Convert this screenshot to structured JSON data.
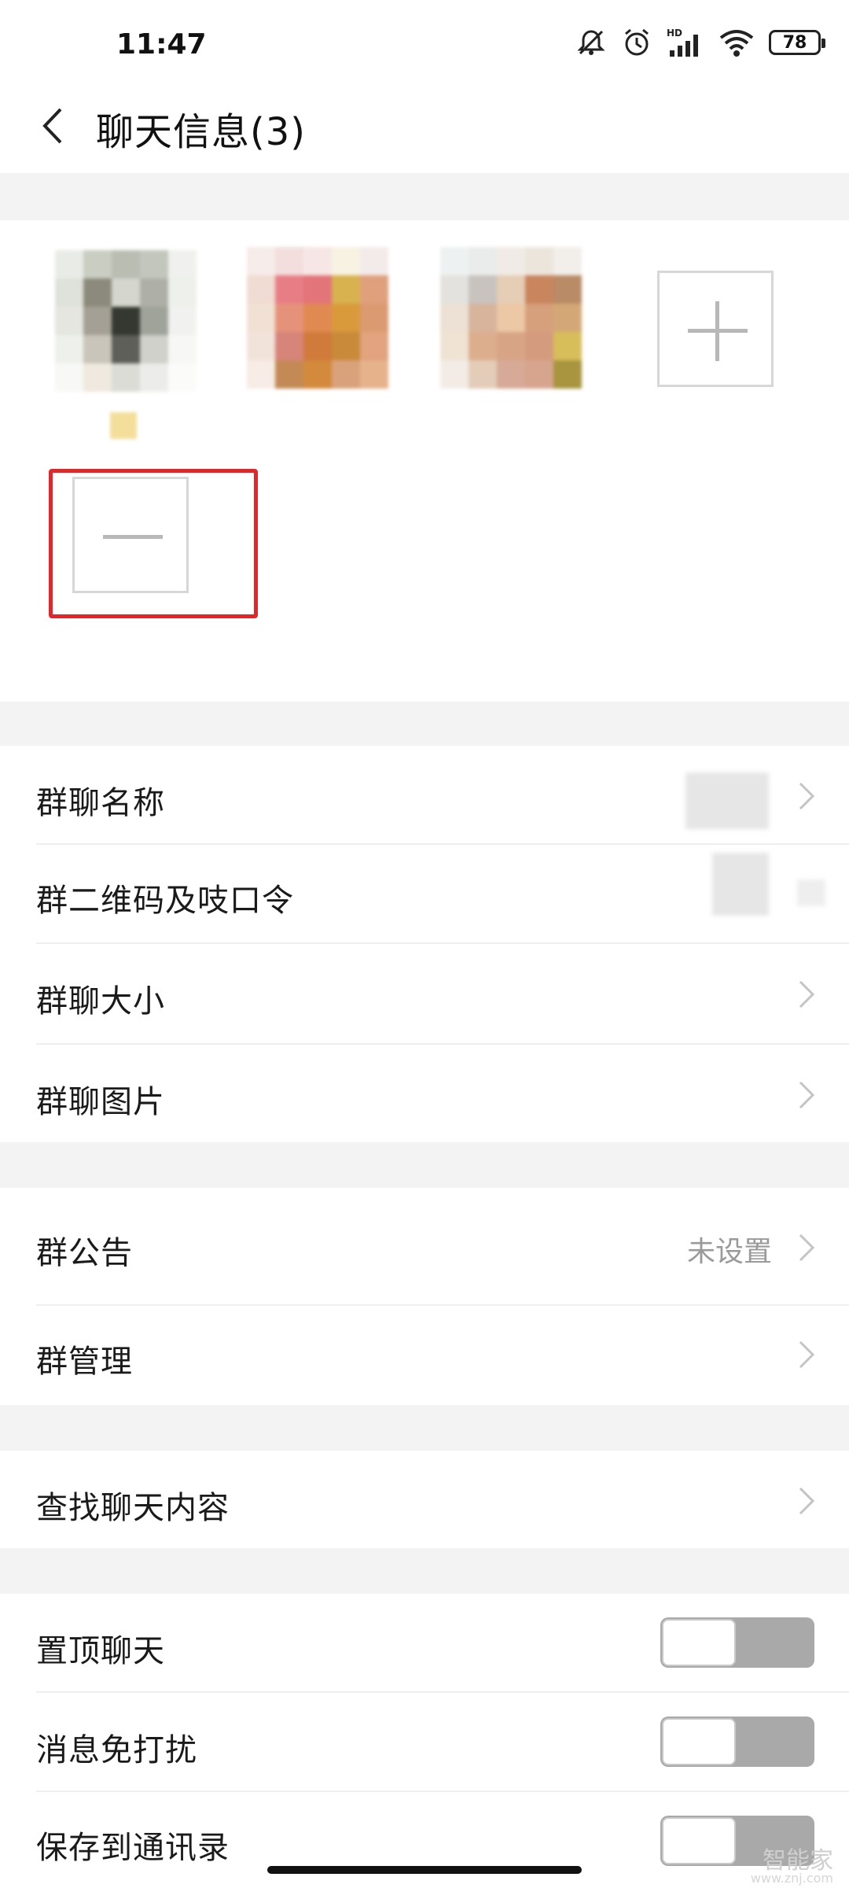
{
  "status_bar": {
    "time": "11:47",
    "icons": [
      "mute-bell-icon",
      "alarm-icon",
      "hd-signal-icon",
      "wifi-icon",
      "battery-icon"
    ],
    "signal_label": "HD",
    "battery_level": "78"
  },
  "header": {
    "back_icon": "chevron-left-icon",
    "title": "聊天信息(3)"
  },
  "members": {
    "avatars": [
      "member-avatar-1",
      "member-avatar-2",
      "member-avatar-3"
    ],
    "add_icon": "plus-icon",
    "remove_icon": "minus-icon",
    "highlight_color": "#e0282b"
  },
  "group_section": {
    "items": [
      {
        "label": "群聊名称",
        "value": ""
      },
      {
        "label": "群二维码及吱口令",
        "value": ""
      },
      {
        "label": "群聊大小",
        "value": ""
      },
      {
        "label": "群聊图片",
        "value": ""
      }
    ]
  },
  "admin_section": {
    "items": [
      {
        "label": "群公告",
        "value": "未设置"
      },
      {
        "label": "群管理",
        "value": ""
      }
    ]
  },
  "search_section": {
    "items": [
      {
        "label": "查找聊天内容"
      }
    ]
  },
  "settings_section": {
    "items": [
      {
        "label": "置顶聊天",
        "on": false
      },
      {
        "label": "消息免打扰",
        "on": false
      },
      {
        "label": "保存到通讯录",
        "on": false
      }
    ]
  },
  "watermark": {
    "text": "智能家",
    "sub": "www.znj.com"
  },
  "colors": {
    "background": "#ffffff",
    "section_gap": "#f3f3f3",
    "toggle_off": "#a9a9a9",
    "secondary_text": "#9a9a9a"
  }
}
